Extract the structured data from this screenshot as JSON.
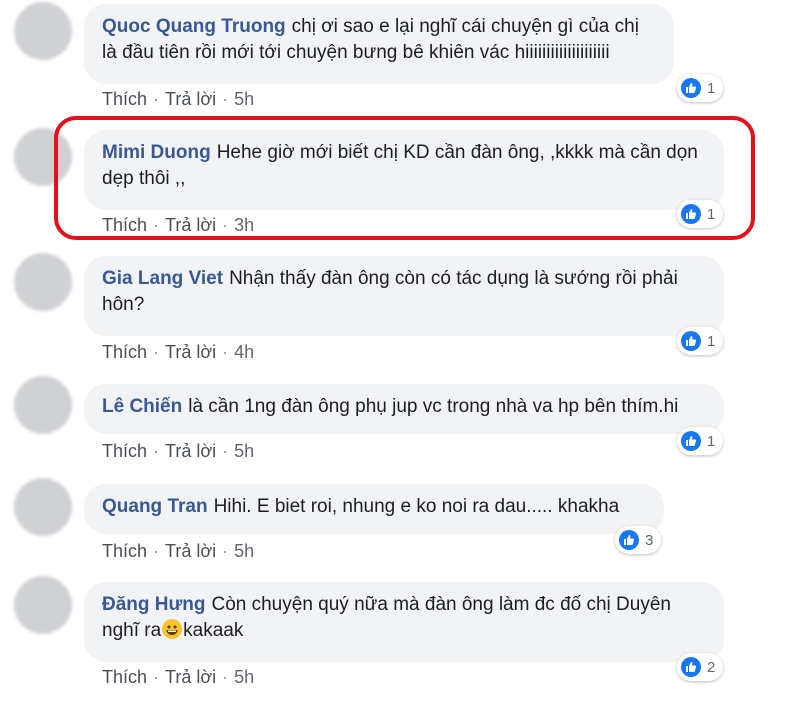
{
  "comments": [
    {
      "author": "Quoc Quang Truong",
      "text": "chị ơi sao e lại nghĩ cái chuyện gì của chị là đầu tiên rồi mới tới chuyện bưng bê khiên vác hiiiiiiiiiiiiiiiiiiii",
      "like": "Thích",
      "reply": "Trả lời",
      "time": "5h",
      "reactions": "1"
    },
    {
      "author": "Mimi Duong",
      "text": "Hehe giờ mới biết chị KD cần đàn ông, ,kkkk mà cần dọn dẹp thôi ,,",
      "like": "Thích",
      "reply": "Trả lời",
      "time": "3h",
      "reactions": "1"
    },
    {
      "author": "Gia Lang Viet",
      "text": "Nhận thấy đàn ông còn có tác dụng là sướng rồi phải hôn?",
      "like": "Thích",
      "reply": "Trả lời",
      "time": "4h",
      "reactions": "1"
    },
    {
      "author": "Lê Chiến",
      "text": "là cần 1ng đàn ông phụ jup vc trong nhà va hp bên thím.hi",
      "like": "Thích",
      "reply": "Trả lời",
      "time": "5h",
      "reactions": "1"
    },
    {
      "author": "Quang Tran",
      "text": "Hihi. E biet roi, nhung e ko noi ra dau..... khakha",
      "like": "Thích",
      "reply": "Trả lời",
      "time": "5h",
      "reactions": "3"
    },
    {
      "author": "Đăng Hưng",
      "text": "Còn chuyện quý nữa mà đàn ông làm đc đố chị Duyên nghĩ ra",
      "text_after_emoji": "kakaak",
      "emoji": "grinning-emoji",
      "like": "Thích",
      "reply": "Trả lời",
      "time": "5h",
      "reactions": "2"
    }
  ],
  "colors": {
    "author": "#385898",
    "bubble": "#f2f3f5",
    "like_badge": "#1877f2",
    "highlight": "#e3111b"
  },
  "icons": {
    "reaction": "like-icon"
  }
}
